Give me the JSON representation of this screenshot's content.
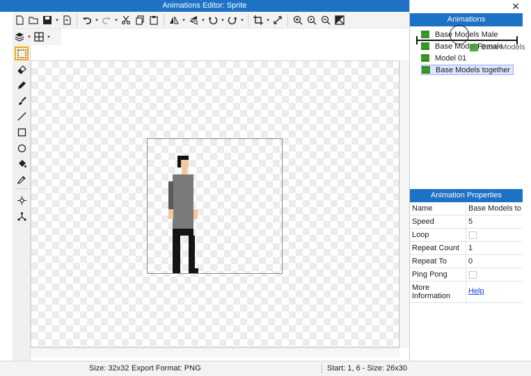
{
  "window": {
    "title": "Animations Editor: Sprite"
  },
  "toolbar": {
    "row1": [
      "new-file-icon",
      "open-folder-icon",
      "save-icon",
      "export-icon",
      "undo-icon",
      "redo-icon",
      "cut-icon",
      "copy-icon",
      "paste-icon",
      "flip-horizontal-icon",
      "flip-vertical-icon",
      "rotate-left-icon",
      "rotate-right-icon",
      "crop-icon",
      "resize-icon",
      "zoom-in-icon",
      "zoom-actual-icon",
      "zoom-out-icon",
      "fit-screen-icon"
    ],
    "row2": [
      "layers-icon",
      "grid-icon"
    ]
  },
  "tools": [
    "rectangle-select-icon",
    "eraser-icon",
    "pencil-icon",
    "brush-icon",
    "line-icon",
    "rectangle-icon",
    "ellipse-icon",
    "fill-bucket-icon",
    "eyedropper-icon",
    "move-point-icon",
    "bone-icon"
  ],
  "sprite_colors": {
    "hair": "#111111",
    "skin": "#f2c6a0",
    "shirt": "#7a7a7a",
    "shirt_dark": "#5a5a5a",
    "pants": "#141414"
  },
  "status": {
    "size": "Size: 32x32",
    "export": "Export Format: PNG",
    "start": "Start: 1, 6 - Size: 26x30"
  },
  "animations": {
    "header": "Animations",
    "items": [
      {
        "label": "Base Models Male",
        "selected": false
      },
      {
        "label": "Base Model Female",
        "selected": false
      },
      {
        "label": "Model 01",
        "selected": false
      },
      {
        "label": "Base Models together",
        "selected": true
      }
    ],
    "drag_ghost": "Base Models"
  },
  "properties": {
    "header": "Animation Properties",
    "name_label": "Name",
    "name_value": "Base Models tog",
    "speed_label": "Speed",
    "speed_value": "5",
    "loop_label": "Loop",
    "loop_checked": false,
    "repeat_count_label": "Repeat Count",
    "repeat_count_value": "1",
    "repeat_to_label": "Repeat To",
    "repeat_to_value": "0",
    "ping_pong_label": "Ping Pong",
    "ping_pong_checked": false,
    "more_info_label": "More Information",
    "help_link": "Help"
  },
  "colors": {
    "accent": "#1e72c6",
    "selection": "#dde6ff",
    "active_tool": "#f3a712",
    "film_icon": "#3a9a2a"
  }
}
